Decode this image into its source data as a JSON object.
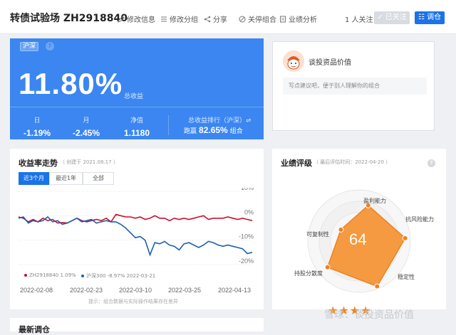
{
  "header": {
    "title": "转债试验场 ZH2918840",
    "links": [
      "修改信息",
      "修改分组",
      "分享",
      "关停组合",
      "业绩分析"
    ],
    "fans": "1 人关注",
    "followed_button": "✓ 已关注",
    "adjust_button": "调仓"
  },
  "summary": {
    "market_tag": "沪深",
    "help": "?",
    "total_return": "11.80%",
    "total_return_label": "总收益",
    "stats": [
      {
        "label": "日",
        "value": "-1.19%"
      },
      {
        "label": "月",
        "value": "-2.45%"
      },
      {
        "label": "净值",
        "value": "1.1180"
      }
    ],
    "rank_label": "总收益排行（沪深）⇌",
    "rank_prefix": "跑赢",
    "rank_value": "82.65%",
    "rank_suffix": "组合"
  },
  "comment": {
    "title": "谈投资品价值",
    "placeholder": "写点建议吧，便于别人理解你的组合"
  },
  "chart_card": {
    "title": "收益率走势",
    "subtitle": "（ 创建于 2021.08.17 ）",
    "ranges": [
      "近3个月",
      "最近1年",
      "全部"
    ],
    "active_range": 0,
    "legend": [
      {
        "label": "ZH2918840 1.09%",
        "color": "#c8102e"
      },
      {
        "label": "沪深300 -8.97% 2022-03-21",
        "color": "#1a5fb4"
      }
    ],
    "hint": "提示：组合数据与实际操作结果存在差异"
  },
  "chart_data": {
    "type": "line",
    "x_ticks": [
      "2022-02-08",
      "2022-02-23",
      "2022-03-10",
      "2022-03-25",
      "2022-04-13"
    ],
    "y_ticks": [
      "10%",
      "0%",
      "-10%",
      "-20%"
    ],
    "ylim": [
      -20,
      10
    ],
    "series": [
      {
        "name": "ZH2918840",
        "color": "#c8102e",
        "values": [
          -0.5,
          -1.0,
          -2.5,
          -1.5,
          -2.5,
          -1.0,
          -2.0,
          -1.5,
          -3.0,
          -2.8,
          -3.0,
          -2.0,
          -1.0,
          -2.0,
          -2.5,
          -2.0,
          -1.5,
          -2.0,
          -1.0,
          -2.5,
          0.5,
          0.0,
          -0.5,
          -0.5,
          -1.0,
          -0.5,
          -1.5,
          -1.0,
          0.0,
          -1.0,
          -1.0,
          -2.0,
          -1.0,
          -1.5,
          -1.0,
          -1.5,
          -1.0,
          -0.5,
          0.0,
          -1.5,
          -1.0,
          -1.0,
          -1.0,
          -0.5,
          -1.0,
          -1.5,
          -1.0,
          -1.5,
          -2.0
        ]
      },
      {
        "name": "沪深300",
        "color": "#1a5fb4",
        "values": [
          -1.0,
          -0.5,
          -3.0,
          -2.0,
          -2.5,
          -2.0,
          -0.5,
          -2.5,
          -2.0,
          -3.5,
          -3.0,
          -2.0,
          -1.0,
          -2.5,
          -2.0,
          -1.5,
          -3.0,
          -2.5,
          -2.0,
          -2.5,
          -2.5,
          -3.5,
          -5.0,
          -7.0,
          -9.0,
          -8.5,
          -10.0,
          -16.0,
          -11.0,
          -11.5,
          -10.5,
          -12.0,
          -12.5,
          -14.0,
          -11.5,
          -11.0,
          -12.0,
          -13.0,
          -12.0,
          -10.5,
          -11.0,
          -12.0,
          -12.5,
          -12.0,
          -12.5,
          -13.0,
          -13.5,
          -15.5,
          -15.0
        ]
      }
    ]
  },
  "rating_card": {
    "title": "业绩评级",
    "subtitle": "（ 最后评估时间：2022-04-20 ）",
    "help": "?",
    "score": "64",
    "stars": "★★★★",
    "dimensions": [
      "盈利能力",
      "抗风险能力",
      "稳定性",
      "持股分散度",
      "可复制性"
    ],
    "dimension_values": [
      0.72,
      0.9,
      0.95,
      0.8,
      0.42
    ]
  },
  "watermark": "雪球：谈投资品价值",
  "bottom_card": {
    "title": "最新调仓"
  },
  "colors": {
    "accent": "#3b86f0",
    "button_blue": "#1a73e8",
    "radar_fill": "#f59a40",
    "radar_stroke": "#f08020"
  }
}
